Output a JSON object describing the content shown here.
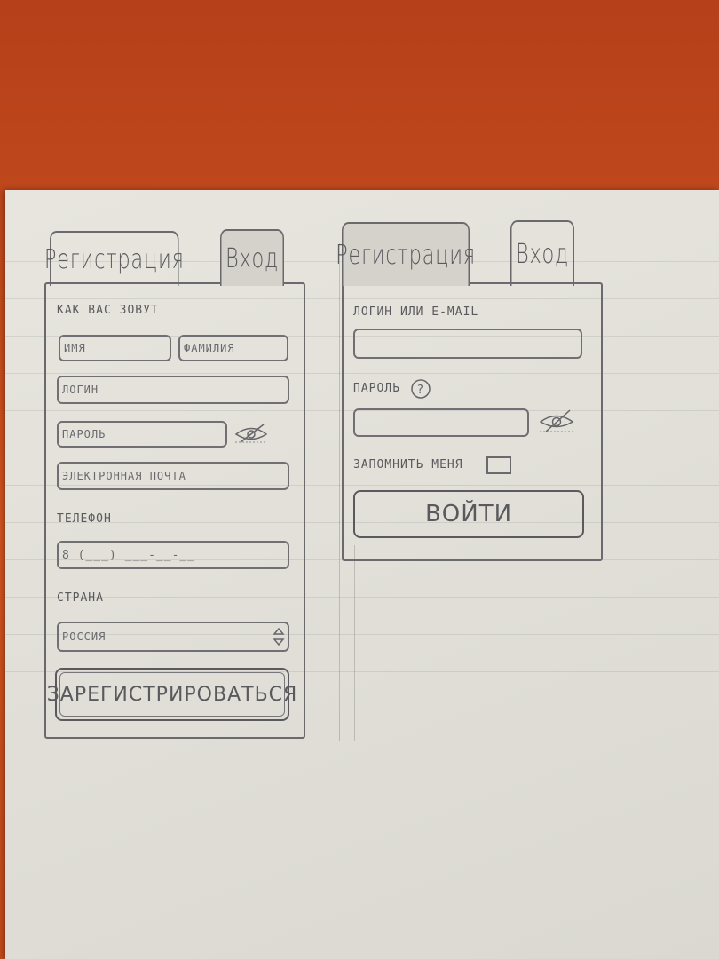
{
  "registration_form": {
    "tabs": {
      "register": "Регистрация",
      "login": "Вход"
    },
    "name_heading": "Как вас зовут",
    "first_name_placeholder": "Имя",
    "last_name_placeholder": "Фамилия",
    "login_placeholder": "Логин",
    "password_placeholder": "Пароль",
    "email_placeholder": "Электронная почта",
    "phone_label": "Телефон",
    "phone_value": "8 (___) ___-__-__",
    "country_label": "Страна",
    "country_value": "Россия",
    "submit_label": "Зарегистрироваться"
  },
  "login_form": {
    "tabs": {
      "register": "Регистрация",
      "login": "Вход"
    },
    "login_label": "Логин или e-mail",
    "password_label": "Пароль",
    "help_icon_glyph": "?",
    "remember_label": "Запомнить меня",
    "submit_label": "Войти"
  },
  "icons": {
    "hide_password": "eye-crossed-icon",
    "help": "question-circle-icon",
    "select_arrows": "up-down-arrows-icon"
  },
  "colors": {
    "desk": "#c9521f",
    "paper": "#e6e4dc",
    "pencil": "#5a5a5e"
  }
}
